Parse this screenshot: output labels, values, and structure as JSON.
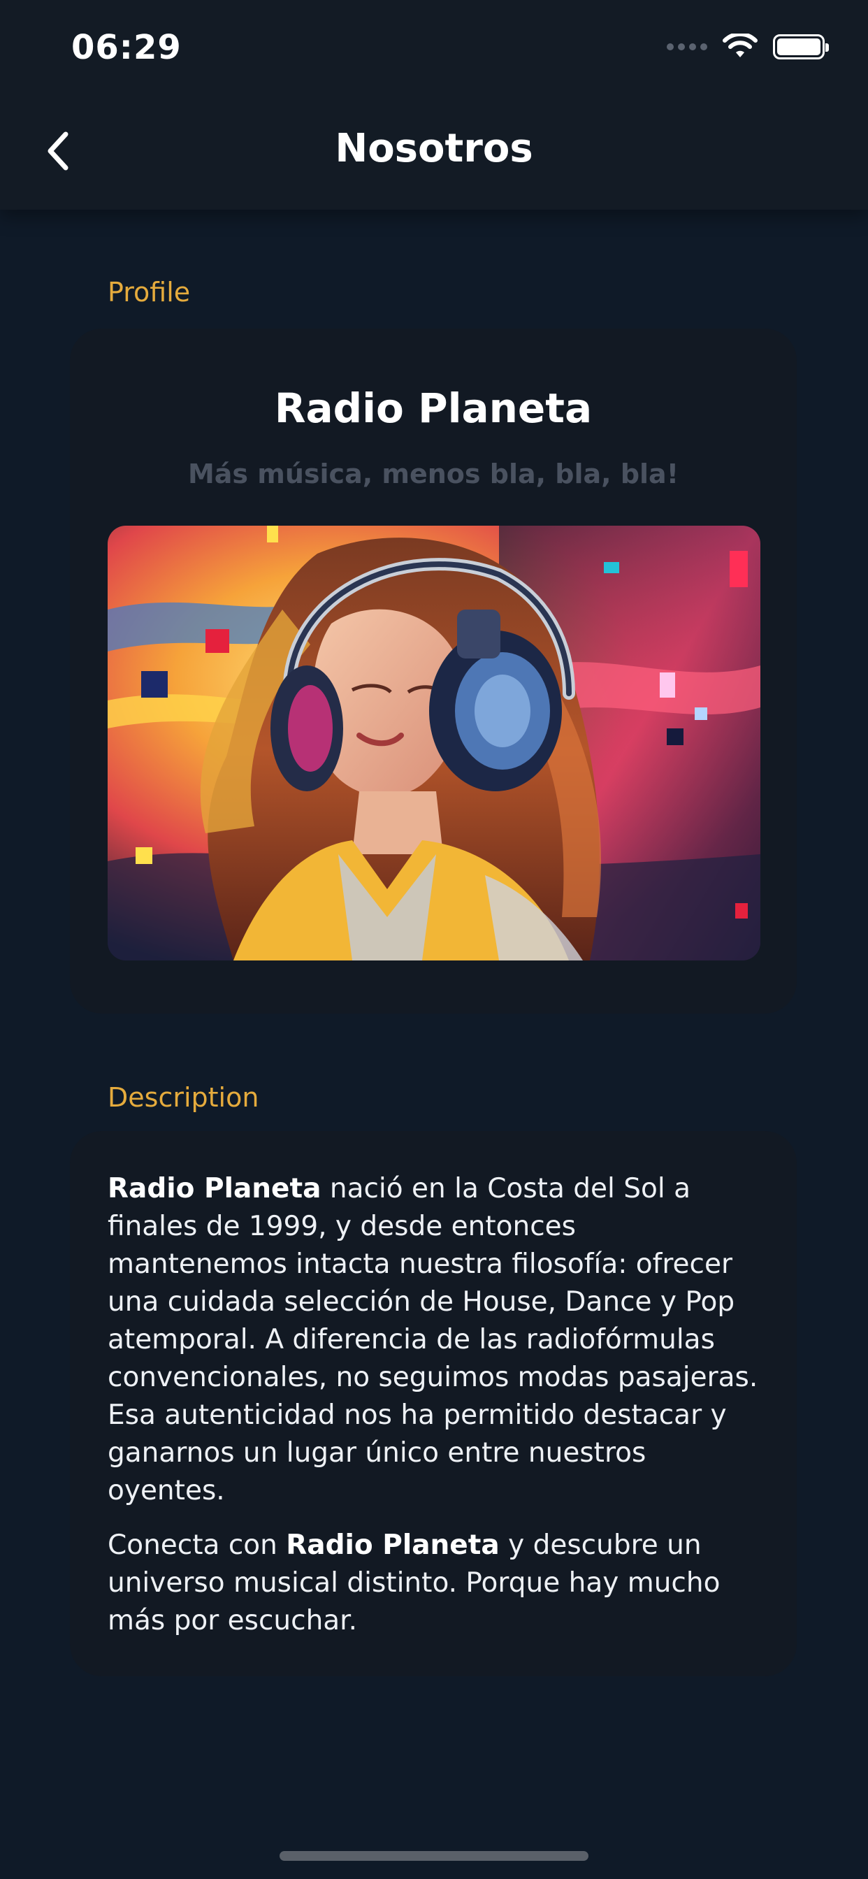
{
  "status_bar": {
    "time": "06:29"
  },
  "header": {
    "title": "Nosotros"
  },
  "profile": {
    "section_label": "Profile",
    "name": "Radio Planeta",
    "tagline": "Más música, menos bla, bla, bla!"
  },
  "description": {
    "section_label": "Description",
    "p1_bold": "Radio Planeta",
    "p1_text": " nació en la Costa del Sol a finales de 1999, y desde entonces mantenemos intacta nuestra filosofía: ofrecer una cuidada selección de House, Dance y Pop atemporal. A diferencia de las radiofórmulas convencionales, no seguimos modas pasajeras. Esa autenticidad nos ha permitido destacar y ganarnos un lugar único entre nuestros oyentes.",
    "p2_text_a": "Conecta con ",
    "p2_bold": "Radio Planeta",
    "p2_text_b": " y descubre un universo musical distinto. Porque hay mucho más por escuchar."
  },
  "icons": {
    "back": "chevron-left-icon",
    "wifi": "wifi-icon",
    "battery": "battery-icon",
    "signal": "cellular-signal-icon"
  },
  "colors": {
    "background": "#0f1a28",
    "header": "#131b25",
    "card": "#121923",
    "accent": "#e5ab3d",
    "tagline": "#4a5260"
  }
}
